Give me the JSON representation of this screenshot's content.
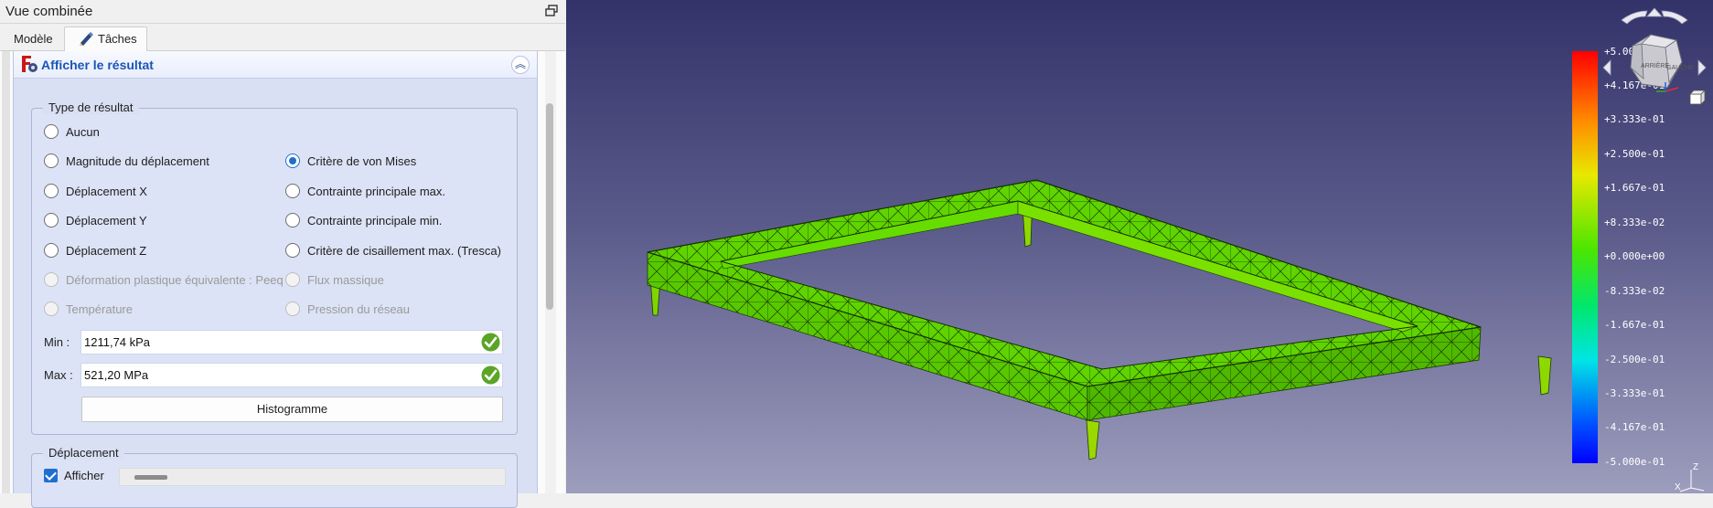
{
  "dock": {
    "title": "Vue combinée"
  },
  "tabs": {
    "model": "Modèle",
    "tasks": "Tâches"
  },
  "panel": {
    "title": "Afficher le résultat",
    "collapse_glyph": "︽"
  },
  "result_type": {
    "title": "Type de résultat",
    "options": [
      {
        "label": "Aucun",
        "checked": false,
        "enabled": true
      },
      {
        "label": "Magnitude du déplacement",
        "checked": false,
        "enabled": true
      },
      {
        "label": "Déplacement X",
        "checked": false,
        "enabled": true
      },
      {
        "label": "Déplacement Y",
        "checked": false,
        "enabled": true
      },
      {
        "label": "Déplacement Z",
        "checked": false,
        "enabled": true
      },
      {
        "label": "Déformation plastique équivalente : Peeq",
        "checked": false,
        "enabled": false
      },
      {
        "label": "Température",
        "checked": false,
        "enabled": false
      },
      {
        "label": "Critère de von Mises",
        "checked": true,
        "enabled": true
      },
      {
        "label": "Contrainte principale max.",
        "checked": false,
        "enabled": true
      },
      {
        "label": "Contrainte principale min.",
        "checked": false,
        "enabled": true
      },
      {
        "label": "Critère de cisaillement max. (Tresca)",
        "checked": false,
        "enabled": true
      },
      {
        "label": "Flux massique",
        "checked": false,
        "enabled": false
      },
      {
        "label": "Pression du réseau",
        "checked": false,
        "enabled": false
      }
    ],
    "min_label": "Min :",
    "min_value": "1211,74 kPa",
    "max_label": "Max :",
    "max_value": "521,20 MPa",
    "histogram_button": "Histogramme"
  },
  "displacement": {
    "title": "Déplacement",
    "show_label": "Afficher",
    "show_checked": true
  },
  "color_scale": {
    "labels": [
      "+5.000e-01",
      "+4.167e-01",
      "+3.333e-01",
      "+2.500e-01",
      "+1.667e-01",
      "+8.333e-02",
      "+0.000e+00",
      "-8.333e-02",
      "-1.667e-01",
      "-2.500e-01",
      "-3.333e-01",
      "-4.167e-01",
      "-5.000e-01"
    ]
  },
  "nav_cube": {
    "face_back": "ARRIÈRE",
    "face_left": "GAUCHE"
  },
  "axis": {
    "z": "Z",
    "x": "X"
  },
  "colors": {
    "accent": "#1f6fd1",
    "mesh": "#5fd400",
    "viewport_top": "#33336a",
    "viewport_bottom": "#9d9dbd"
  }
}
